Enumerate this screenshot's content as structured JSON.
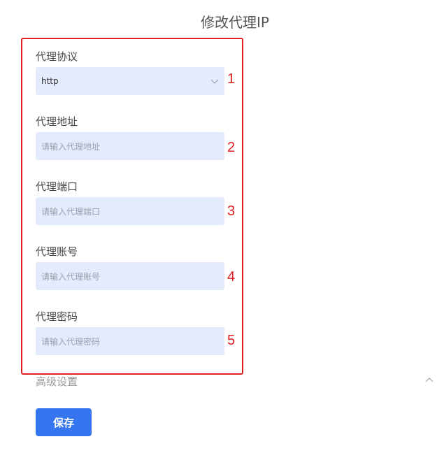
{
  "page": {
    "title": "修改代理IP"
  },
  "form": {
    "protocol": {
      "label": "代理协议",
      "value": "http",
      "marker": "1"
    },
    "address": {
      "label": "代理地址",
      "placeholder": "请输入代理地址",
      "marker": "2"
    },
    "port": {
      "label": "代理端口",
      "placeholder": "请输入代理端口",
      "marker": "3"
    },
    "account": {
      "label": "代理账号",
      "placeholder": "请输入代理账号",
      "marker": "4"
    },
    "password": {
      "label": "代理密码",
      "placeholder": "请输入代理密码",
      "marker": "5"
    }
  },
  "advanced": {
    "label": "高级设置"
  },
  "actions": {
    "save_label": "保存"
  },
  "colors": {
    "accent": "#3575f0",
    "field_bg": "#e3ebfd",
    "highlight": "#e02020"
  },
  "icons": {
    "select": "chevron-down-icon",
    "advanced": "chevron-up-icon"
  }
}
